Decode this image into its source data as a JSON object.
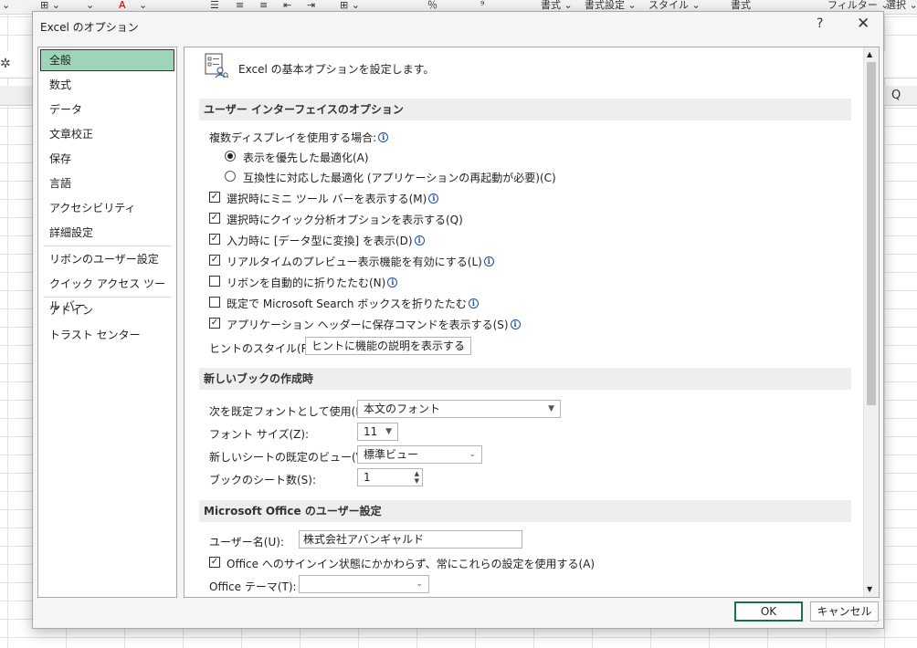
{
  "ribbon": {
    "items": [
      "⌄",
      "⊞ ⌄",
      "⌄",
      "A",
      "⌄",
      "☰",
      "≡",
      "≡",
      "⇤",
      "⇥",
      "⊞ ⌄",
      "％",
      "⁹",
      "書式 ⌄",
      "書式設定 ⌄",
      "スタイル ⌄",
      "書式",
      "フィルター ⌄",
      "選択 ⌄"
    ]
  },
  "sheet": {
    "column_q": "Q"
  },
  "dialog": {
    "title": "Excel のオプション",
    "help": "?",
    "close": "✕",
    "nav": [
      "全般",
      "数式",
      "データ",
      "文章校正",
      "保存",
      "言語",
      "アクセシビリティ",
      "詳細設定",
      "リボンのユーザー設定",
      "クイック アクセス ツール バー",
      "アドイン",
      "トラスト センター"
    ],
    "header_text": "Excel の基本オプションを設定します。",
    "ui_section": {
      "title": "ユーザー インターフェイスのオプション",
      "multi_display_label": "複数ディスプレイを使用する場合:",
      "radio_display": "表示を優先した最適化(A)",
      "radio_compat": "互換性に対応した最適化 (アプリケーションの再起動が必要)(C)",
      "opt_mini_toolbar": "選択時にミニ ツール バーを表示する(M)",
      "opt_quick_analysis": "選択時にクイック分析オプションを表示する(Q)",
      "opt_data_type": "入力時に [データ型に変換] を表示(D)",
      "opt_live_preview": "リアルタイムのプレビュー表示機能を有効にする(L)",
      "opt_collapse_ribbon": "リボンを自動的に折りたたむ(N)",
      "opt_collapse_search": "既定で Microsoft Search ボックスを折りたたむ",
      "opt_save_commands": "アプリケーション ヘッダーに保存コマンドを表示する(S)",
      "tooltip_label": "ヒントのスタイル(R):",
      "tooltip_value": "ヒントに機能の説明を表示する"
    },
    "new_book_section": {
      "title": "新しいブックの作成時",
      "font_label": "次を既定フォントとして使用(N):",
      "font_value": "本文のフォント",
      "size_label": "フォント サイズ(Z):",
      "size_value": "11",
      "view_label": "新しいシートの既定のビュー(V):",
      "view_value": "標準ビュー",
      "sheets_label": "ブックのシート数(S):",
      "sheets_value": "1"
    },
    "office_section": {
      "title": "Microsoft Office のユーザー設定",
      "username_label": "ユーザー名(U):",
      "username_value": "株式会社アバンギャルド",
      "always_use_label": "Office へのサインイン状態にかかわらず、常にこれらの設定を使用する(A)",
      "theme_label": "Office テーマ(T):",
      "theme_value": ""
    },
    "ok_button": "OK",
    "cancel_button": "キャンセル"
  }
}
